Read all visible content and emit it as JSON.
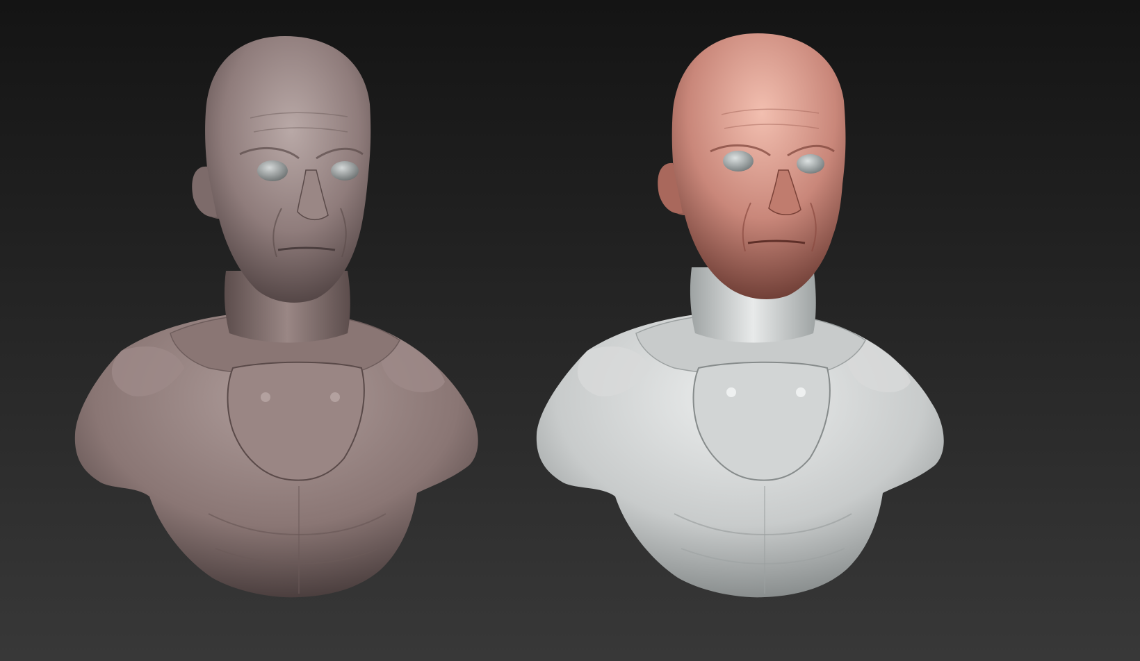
{
  "scene": {
    "background_top": "#141414",
    "background_bottom": "#383838",
    "models": [
      {
        "id": "sculpt-clay",
        "head_color": "#8f7c7b",
        "head_highlight": "#b9a9a7",
        "head_shadow": "#4a3d3d",
        "body_color": "#8a7674",
        "body_highlight": "#ae9c9a",
        "body_shadow": "#3f3434",
        "eye_color": "#9fa5a6"
      },
      {
        "id": "sculpt-painted",
        "head_color": "#c9877a",
        "head_highlight": "#f2bfb0",
        "head_shadow": "#6b3b33",
        "body_color": "#c8cbcb",
        "body_highlight": "#eceeee",
        "body_shadow": "#7d8282",
        "eye_color": "#a9b0b1"
      }
    ]
  }
}
